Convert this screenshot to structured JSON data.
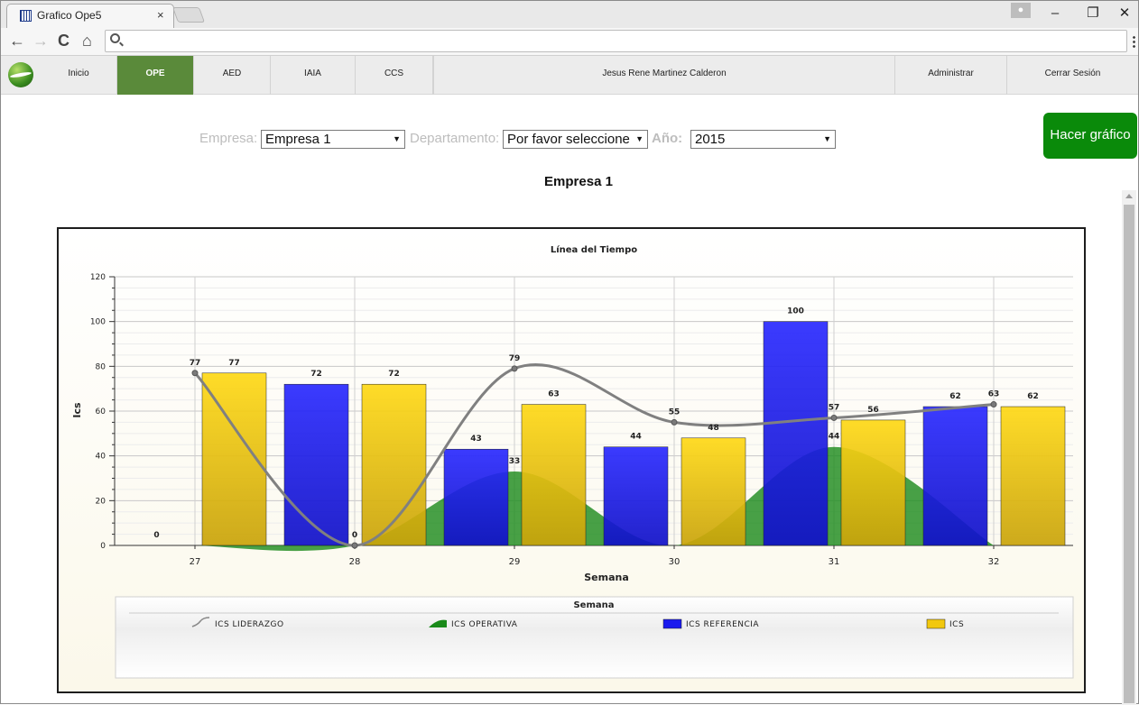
{
  "browser": {
    "tab_title": "Grafico Ope5",
    "tab_close": "×",
    "back": "←",
    "forward": "→",
    "reload": "C",
    "home": "⌂",
    "minimize": "–",
    "restore": "❐",
    "close": "✕"
  },
  "nav": {
    "items": [
      {
        "label": "Inicio"
      },
      {
        "label": "OPE"
      },
      {
        "label": "AED"
      },
      {
        "label": "IAIA"
      },
      {
        "label": "CCS"
      }
    ],
    "user_name": "Jesus Rene Martinez Calderon",
    "admin_label": "Administrar",
    "logout_label": "Cerrar Sesión"
  },
  "filters": {
    "empresa_label": "Empresa:",
    "empresa_value": "Empresa 1",
    "departamento_label": "Departamento:",
    "departamento_value": "Por favor seleccione",
    "anio_label": "Año:",
    "anio_value": "2015",
    "submit_label": "Hacer gráfico"
  },
  "heading": "Empresa 1",
  "chart_data": {
    "type": "bar",
    "title": "Línea del Tiempo",
    "xlabel": "Semana",
    "ylabel": "Ics",
    "ylim": [
      0,
      120
    ],
    "yticks": [
      0,
      20,
      40,
      60,
      80,
      100,
      120
    ],
    "categories": [
      "27",
      "28",
      "29",
      "30",
      "31",
      "32"
    ],
    "legend_title": "Semana",
    "grid": true,
    "series": [
      {
        "name": "ICS LIDERAZGO",
        "kind": "spline",
        "color": "#808080",
        "values": [
          77,
          0,
          79,
          55,
          57,
          63
        ]
      },
      {
        "name": "ICS OPERATIVA",
        "kind": "area",
        "color": "#1a8a1a",
        "values": [
          0,
          0,
          33,
          0,
          44,
          0
        ]
      },
      {
        "name": "ICS REFERENCIA",
        "kind": "bar",
        "color": "#1a1aee",
        "values": [
          0,
          72,
          43,
          44,
          100,
          62
        ]
      },
      {
        "name": "ICS",
        "kind": "bar",
        "color": "#f2c80e",
        "values": [
          77,
          72,
          63,
          48,
          56,
          62
        ]
      }
    ]
  }
}
